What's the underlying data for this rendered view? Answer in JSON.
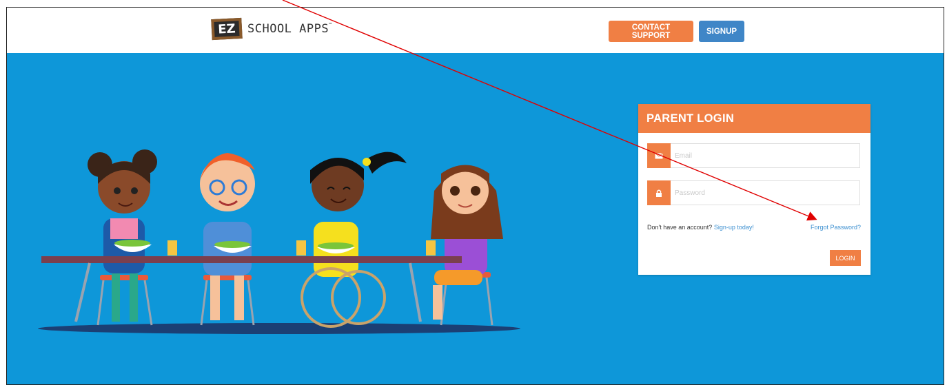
{
  "header": {
    "logo_mark": "EZ",
    "logo_text": "SCHOOL APPS",
    "logo_tm": "™",
    "contact_label": "CONTACT SUPPORT",
    "signup_label": "SIGNUP"
  },
  "login": {
    "title": "PARENT LOGIN",
    "email_placeholder": "Email",
    "password_placeholder": "Password",
    "no_account_text": "Don't have an account?",
    "signup_link": "Sign-up today!",
    "forgot_link": "Forgot Password?",
    "login_label": "LOGIN"
  },
  "icons": {
    "email": "envelope-icon",
    "password": "lock-icon"
  },
  "colors": {
    "accent_orange": "#f07f44",
    "signup_blue": "#3f86c7",
    "hero_blue": "#0e97d9",
    "annotation_red": "#e00000"
  }
}
